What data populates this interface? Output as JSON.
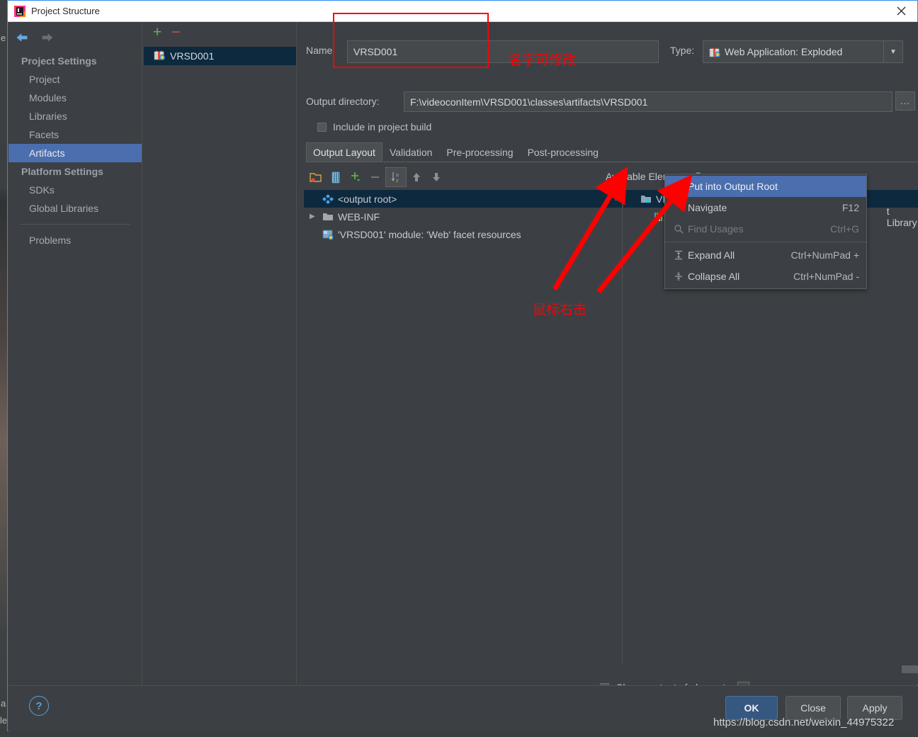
{
  "window": {
    "title": "Project Structure",
    "close_icon": "close-icon",
    "app_icon": "intellij-idea-icon"
  },
  "sidebar": {
    "back_icon": "arrow-left-icon",
    "forward_icon": "arrow-right-icon",
    "groups": [
      {
        "header": "Project Settings",
        "items": [
          {
            "label": "Project",
            "selected": false
          },
          {
            "label": "Modules",
            "selected": false
          },
          {
            "label": "Libraries",
            "selected": false
          },
          {
            "label": "Facets",
            "selected": false
          },
          {
            "label": "Artifacts",
            "selected": true
          }
        ]
      },
      {
        "header": "Platform Settings",
        "items": [
          {
            "label": "SDKs",
            "selected": false
          },
          {
            "label": "Global Libraries",
            "selected": false
          }
        ]
      }
    ],
    "problems": "Problems"
  },
  "artifacts_list": {
    "add_icon": "plus-icon",
    "remove_icon": "minus-icon",
    "items": [
      {
        "label": "VRSD001",
        "icon": "artifact-gift-icon",
        "selected": true
      }
    ]
  },
  "details": {
    "name_label": "Name:",
    "name_label_mnemonic": "m",
    "name_value": "VRSD001",
    "type_label": "Type:",
    "type_value": "Web Application: Exploded",
    "type_icon": "artifact-gift-icon",
    "type_dropdown_icon": "chevron-down-icon",
    "output_dir_label": "Output directory:",
    "output_dir_value": "F:\\videoconItem\\VRSD001\\classes\\artifacts\\VRSD001",
    "browse_label": "...",
    "include_in_build_label": "Include in project build",
    "include_in_build_mnemonic": "b",
    "include_in_build_checked": false
  },
  "tabs": [
    {
      "label": "Output Layout",
      "active": true
    },
    {
      "label": "Validation",
      "active": false
    },
    {
      "label": "Pre-processing",
      "active": false
    },
    {
      "label": "Post-processing",
      "active": false
    }
  ],
  "layout_toolbar": {
    "buttons": [
      {
        "name": "create-directory-icon",
        "icon": "folder-add-icon",
        "boxed": false
      },
      {
        "name": "create-archive-icon",
        "icon": "archive-icon",
        "boxed": false
      },
      {
        "name": "add-copy-icon",
        "icon": "plus-dropdown-icon",
        "boxed": false
      },
      {
        "name": "remove-icon",
        "icon": "minus-icon",
        "boxed": false
      },
      {
        "name": "sort-az-icon",
        "icon": "sort-alpha-icon",
        "boxed": true
      },
      {
        "name": "move-up-icon",
        "icon": "arrow-up-icon",
        "boxed": false
      },
      {
        "name": "move-down-icon",
        "icon": "arrow-down-icon",
        "boxed": false
      }
    ],
    "available_elements_label": "Available Elements",
    "help_icon": "question-mark-icon"
  },
  "output_tree": [
    {
      "label": "<output root>",
      "icon": "output-root-icon",
      "indent": 0,
      "selected": true,
      "expander": "none"
    },
    {
      "label": "WEB-INF",
      "icon": "folder-icon",
      "indent": 0,
      "selected": false,
      "expander": "collapsed"
    },
    {
      "label": "'VRSD001' module: 'Web' facet resources",
      "icon": "module-facet-icon",
      "indent": 1,
      "selected": false,
      "expander": "none"
    }
  ],
  "available_tree": [
    {
      "label": "VRSD001",
      "icon": "folder-module-icon",
      "indent": 0,
      "selected": true,
      "expander": "expanded"
    },
    {
      "label": "a",
      "suffix_label": "t Library",
      "icon": "library-icon",
      "indent": 1,
      "selected": false,
      "expander": "none"
    }
  ],
  "context_menu": {
    "items": [
      {
        "label": "Put into Output Root",
        "shortcut": "",
        "icon": "",
        "state": "highlight"
      },
      {
        "label": "Navigate",
        "shortcut": "F12",
        "icon": "",
        "state": "normal"
      },
      {
        "label": "Find Usages",
        "shortcut": "Ctrl+G",
        "icon": "search-icon",
        "state": "disabled"
      },
      {
        "label": "Expand All",
        "shortcut": "Ctrl+NumPad +",
        "icon": "expand-all-icon",
        "state": "normal",
        "separator_before": true
      },
      {
        "label": "Collapse All",
        "shortcut": "Ctrl+NumPad -",
        "icon": "collapse-all-icon",
        "state": "normal"
      }
    ]
  },
  "footer": {
    "show_content_label": "Show content of elements",
    "show_content_checked": false,
    "show_content_dots": "…",
    "help_icon": "question-mark-icon",
    "buttons": [
      {
        "label": "OK",
        "primary": true,
        "name": "ok-button"
      },
      {
        "label": "Close",
        "primary": false,
        "name": "close-button"
      },
      {
        "label": "Apply",
        "primary": false,
        "name": "apply-button"
      }
    ]
  },
  "annotations": {
    "name_note": "名字可修改",
    "right_click_note": "鼠标右击",
    "box_color": "#ff0000",
    "arrow_color": "#ff0000"
  },
  "watermark": "https://blog.csdn.net/weixin_44975322",
  "colors": {
    "dialog_bg": "#3c4044",
    "selection_blue": "#4b6eaf",
    "tree_selection": "#0d293e",
    "accent_link": "#5f9fd8",
    "border": "#5a5f63",
    "text": "#c8ccd0",
    "primary_button": "#365880",
    "window_border": "#2d8cf0"
  }
}
